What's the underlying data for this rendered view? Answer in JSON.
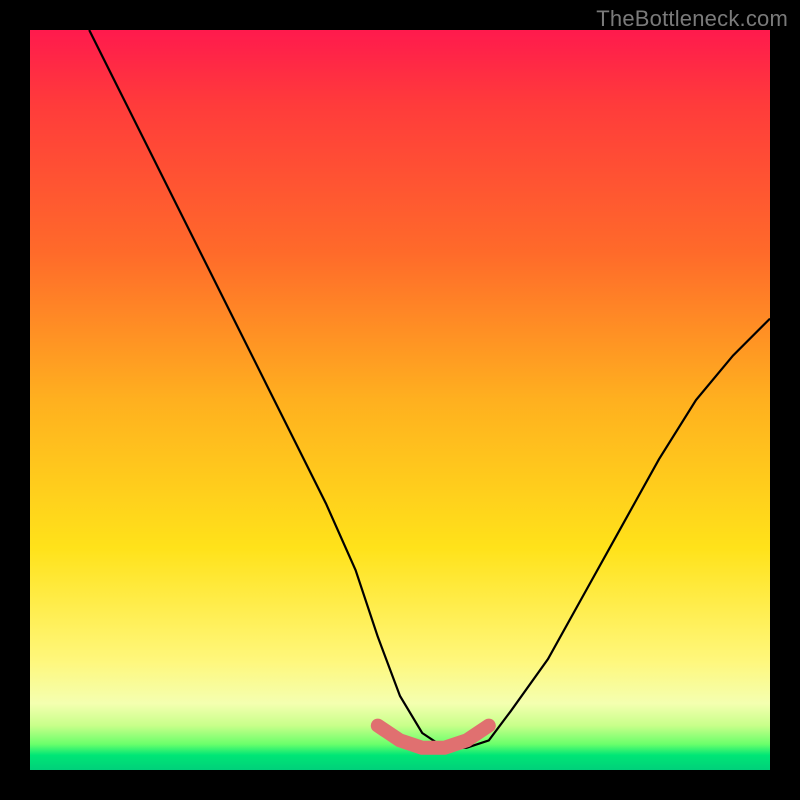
{
  "watermark": "TheBottleneck.com",
  "chart_data": {
    "type": "line",
    "title": "",
    "xlabel": "",
    "ylabel": "",
    "xlim": [
      0,
      100
    ],
    "ylim": [
      0,
      100
    ],
    "series": [
      {
        "name": "main-curve",
        "color": "#000000",
        "x": [
          8,
          12,
          16,
          20,
          24,
          28,
          32,
          36,
          40,
          44,
          47,
          50,
          53,
          56,
          59,
          62,
          65,
          70,
          75,
          80,
          85,
          90,
          95,
          100
        ],
        "y": [
          100,
          92,
          84,
          76,
          68,
          60,
          52,
          44,
          36,
          27,
          18,
          10,
          5,
          3,
          3,
          4,
          8,
          15,
          24,
          33,
          42,
          50,
          56,
          61
        ]
      },
      {
        "name": "bottom-highlight",
        "color": "#e07070",
        "x": [
          47,
          50,
          53,
          56,
          59,
          62
        ],
        "y": [
          6,
          4,
          3,
          3,
          4,
          6
        ]
      }
    ],
    "gradient_stops": [
      {
        "pos": 0,
        "color": "#ff1a4d"
      },
      {
        "pos": 30,
        "color": "#ff6a2a"
      },
      {
        "pos": 70,
        "color": "#ffe21a"
      },
      {
        "pos": 96,
        "color": "#6bff6b"
      },
      {
        "pos": 100,
        "color": "#00d07a"
      }
    ]
  }
}
